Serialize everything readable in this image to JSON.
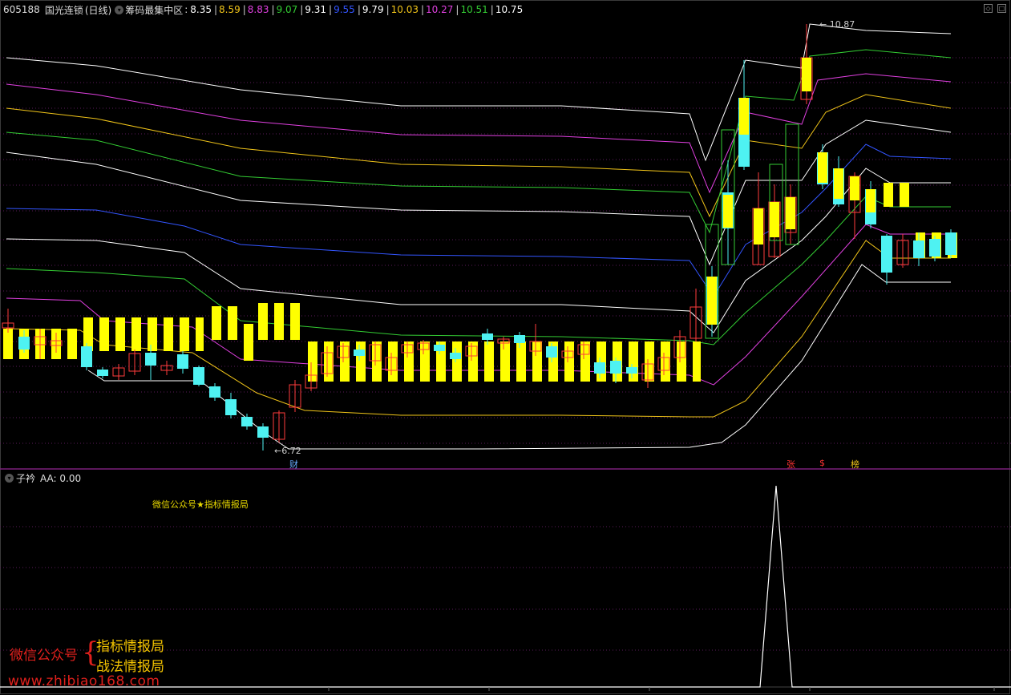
{
  "header": {
    "code": "605188",
    "name": "国光连锁",
    "period": "(日线)",
    "indicator": "筹码最集中区",
    "levels": [
      {
        "text": "8.35",
        "color": "#ffffff"
      },
      {
        "text": "8.59",
        "color": "#f0c419"
      },
      {
        "text": "8.83",
        "color": "#e040e0"
      },
      {
        "text": "9.07",
        "color": "#33cc33"
      },
      {
        "text": "9.31",
        "color": "#ffffff"
      },
      {
        "text": "9.55",
        "color": "#3355ff"
      },
      {
        "text": "9.79",
        "color": "#ffffff"
      },
      {
        "text": "10.03",
        "color": "#f0c419"
      },
      {
        "text": "10.27",
        "color": "#e040e0"
      },
      {
        "text": "10.51",
        "color": "#33cc33"
      },
      {
        "text": "10.75",
        "color": "#ffffff"
      }
    ]
  },
  "price_labels": {
    "low": "←6.72",
    "high": "← 10.87"
  },
  "annotations": [
    {
      "text": "财",
      "color": "#66aaff"
    },
    {
      "text": "张",
      "color": "#ff3333"
    },
    {
      "text": "$",
      "color": "#ff3333"
    },
    {
      "text": "榜",
      "color": "#f0c419"
    }
  ],
  "sub_panel": {
    "name": "子衿",
    "value_label": "AA: 0.00",
    "promo": "微信公众号★指标情报局"
  },
  "watermark": {
    "lead": "微信公众号",
    "line1": "指标情报局",
    "line2": "战法情报局",
    "url": "www.zhibiao168.com"
  },
  "colors": {
    "up": "#ff3b3b",
    "down": "#4ef2f2",
    "band": "#ffff00",
    "grid": "#5a1a5a",
    "divider": "#7a1f7a"
  },
  "chart_data": {
    "type": "candlestick",
    "title": "605188 国光连锁 (日线)",
    "low": 6.72,
    "high": 10.87,
    "indicator_series": [
      "8.35",
      "8.59",
      "8.83",
      "9.07",
      "9.31",
      "9.55",
      "9.79",
      "10.03",
      "10.27",
      "10.51",
      "10.75"
    ],
    "sub_indicator": {
      "name": "AA",
      "value": 0.0
    }
  }
}
